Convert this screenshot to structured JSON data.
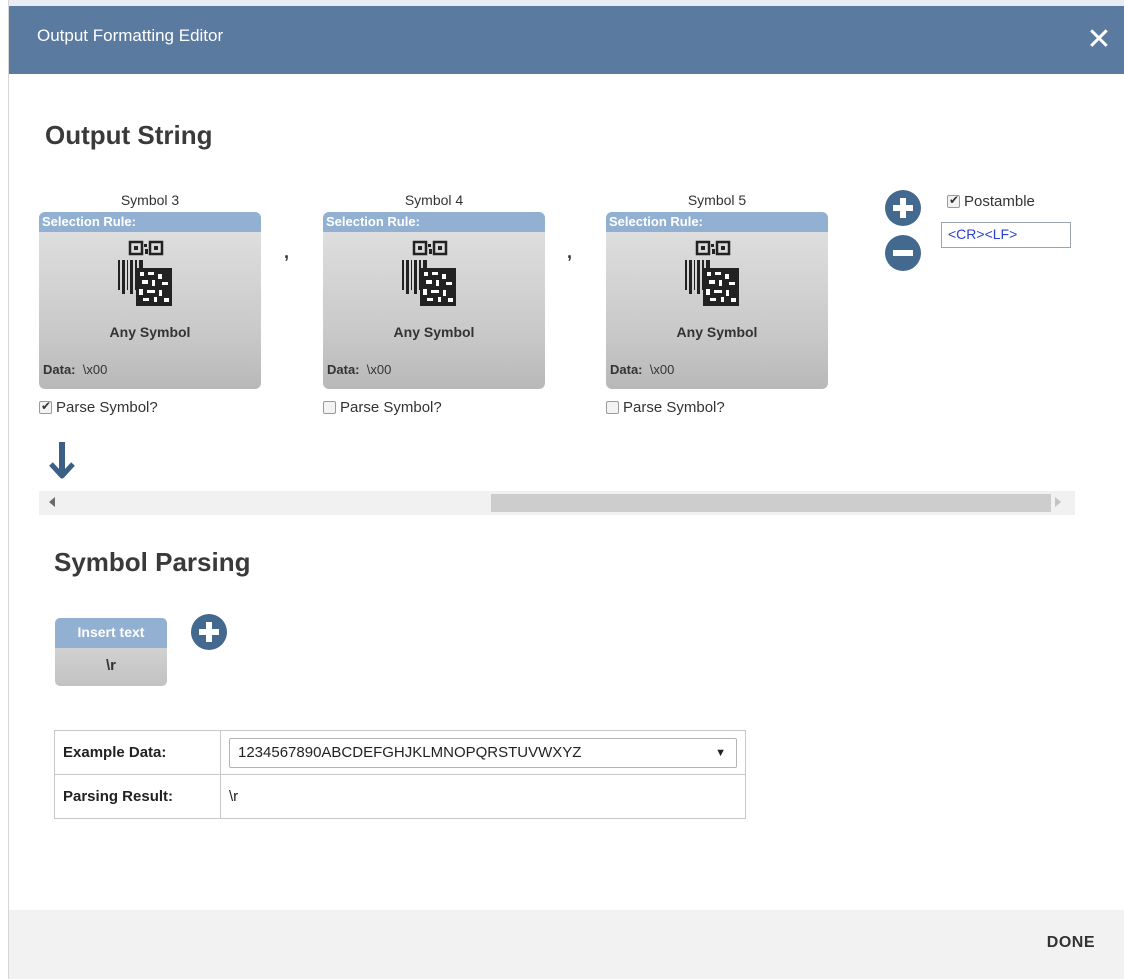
{
  "dialog": {
    "title": "Output Formatting Editor"
  },
  "output": {
    "heading": "Output String",
    "symbols": [
      {
        "name": "Symbol 3",
        "rule_label": "Selection Rule:",
        "rule_value": "Any Symbol",
        "data_label": "Data:",
        "data_value": "\\x00",
        "parse_label": "Parse Symbol?",
        "parse_checked": true
      },
      {
        "name": "Symbol 4",
        "rule_label": "Selection Rule:",
        "rule_value": "Any Symbol",
        "data_label": "Data:",
        "data_value": "\\x00",
        "parse_label": "Parse Symbol?",
        "parse_checked": false
      },
      {
        "name": "Symbol 5",
        "rule_label": "Selection Rule:",
        "rule_value": "Any Symbol",
        "data_label": "Data:",
        "data_value": "\\x00",
        "parse_label": "Parse Symbol?",
        "parse_checked": false
      }
    ],
    "separators": [
      ",",
      ","
    ],
    "postamble": {
      "label": "Postamble",
      "checked": true,
      "value": "<CR><LF>"
    }
  },
  "parsing": {
    "heading": "Symbol Parsing",
    "insert_card": {
      "label": "Insert text",
      "value": "\\r"
    },
    "example_label": "Example Data:",
    "example_value": "1234567890ABCDEFGHJKLMNOPQRSTUVWXYZ",
    "result_label": "Parsing Result:",
    "result_value": "\\r"
  },
  "footer": {
    "done_label": "DONE"
  },
  "colors": {
    "titlebar": "#5a7aa0",
    "card_header": "#92b1d2",
    "round_button": "#44698f",
    "postamble_text": "#2a3fd0"
  }
}
